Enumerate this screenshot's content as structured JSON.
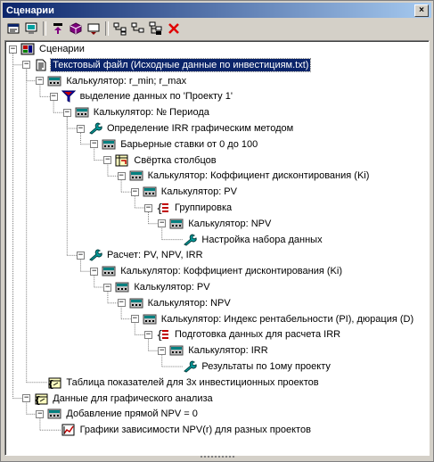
{
  "window": {
    "title": "Сценарии",
    "close_glyph": "×"
  },
  "toolbar": {
    "buttons": [
      "properties-icon",
      "view-icon",
      "import-icon",
      "process-icon",
      "export-icon",
      "expand-all-icon",
      "collapse-all-icon",
      "tree-icon",
      "delete-icon"
    ]
  },
  "tree": {
    "nodes": [
      {
        "label": "Сценарии",
        "icon": "root-scenario-icon"
      },
      {
        "label": "Текстовый файл (Исходные данные по инвестициям.txt)",
        "icon": "text-file-icon",
        "selected": true
      },
      {
        "label": "Калькулятор: r_min; r_max",
        "icon": "calculator-icon"
      },
      {
        "label": "выделение данных по 'Проекту 1'",
        "icon": "filter-icon"
      },
      {
        "label": "Калькулятор: № Периода",
        "icon": "calculator-icon"
      },
      {
        "label": "Определение IRR графическим методом",
        "icon": "wrench-icon"
      },
      {
        "label": "Барьерные ставки от 0 до 100",
        "icon": "calculator-icon"
      },
      {
        "label": "Свёртка столбцов",
        "icon": "unpivot-icon"
      },
      {
        "label": "Калькулятор: Коффициент дисконтирования (Ki)",
        "icon": "calculator-icon"
      },
      {
        "label": "Калькулятор: PV",
        "icon": "calculator-icon"
      },
      {
        "label": "Группировка",
        "icon": "group-icon"
      },
      {
        "label": "Калькулятор: NPV",
        "icon": "calculator-icon"
      },
      {
        "label": "Настройка набора данных",
        "icon": "wrench-icon"
      },
      {
        "label": "Расчет: PV, NPV, IRR",
        "icon": "wrench-icon"
      },
      {
        "label": "Калькулятор: Коффициент дисконтирования (Ki)",
        "icon": "calculator-icon"
      },
      {
        "label": "Калькулятор: PV",
        "icon": "calculator-icon"
      },
      {
        "label": "Калькулятор: NPV",
        "icon": "calculator-icon"
      },
      {
        "label": "Калькулятор: Индекс рентабельности (PI), дюрация (D)",
        "icon": "calculator-icon"
      },
      {
        "label": "Подготовка данных для расчета IRR",
        "icon": "group-icon"
      },
      {
        "label": "Калькулятор: IRR",
        "icon": "calculator-icon"
      },
      {
        "label": "Результаты по 1ому проекту",
        "icon": "wrench-icon"
      },
      {
        "label": "Таблица показателей для 3х инвестиционных проектов",
        "icon": "table-icon"
      },
      {
        "label": "Данные для графического анализа",
        "icon": "table-icon"
      },
      {
        "label": "Добавление прямой  NPV = 0",
        "icon": "calculator-icon"
      },
      {
        "label": "Графики зависимости NPV(r) для разных проектов",
        "icon": "chart-icon"
      }
    ]
  },
  "expander": {
    "minus": "−"
  }
}
